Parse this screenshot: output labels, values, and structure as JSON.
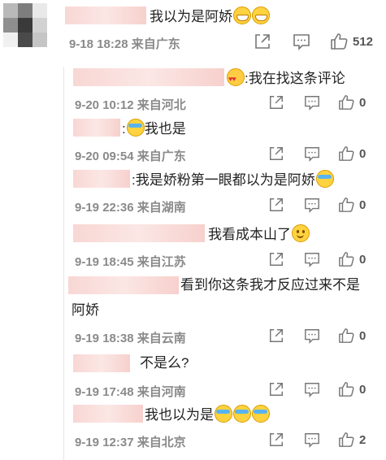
{
  "main": {
    "text": "我以为是阿娇",
    "emojis": [
      "grin",
      "grin"
    ],
    "meta": "9-18 18:28 来自广东",
    "like_count": "512"
  },
  "replies": [
    {
      "text": ":我在找这条评论",
      "emoji_before": "love",
      "meta": "9-20 10:12 来自河北",
      "likes": "0"
    },
    {
      "text": "我也是",
      "emoji_before": "cry",
      "prefix": ":",
      "meta": "9-20 09:54 来自广东",
      "likes": "0"
    },
    {
      "text": ":我是娇粉第一眼都以为是阿娇",
      "emoji_after": "cry",
      "meta": "9-19 22:36 来自湖南",
      "likes": "0"
    },
    {
      "text": "我看成本山了",
      "emoji_after": "smile",
      "meta": "9-19 18:45 来自江苏",
      "likes": "0"
    },
    {
      "text": "看到你这条我才反应过来不是",
      "text_line2": "阿娇",
      "meta": "9-19 18:38 来自云南",
      "likes": "0"
    },
    {
      "text": "不是么?",
      "meta": "9-19 17:48 来自河南",
      "likes": "0"
    },
    {
      "text": "我也以为是",
      "emoji_after": "cry x3",
      "meta": "9-19 12:37 来自北京",
      "likes": "2"
    }
  ],
  "icons": [
    "share-icon",
    "comment-icon",
    "like-icon"
  ]
}
